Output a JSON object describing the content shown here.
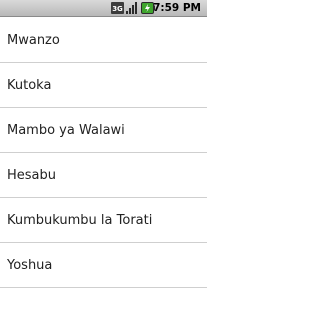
{
  "status_bar": {
    "network_label": "3G",
    "time": "7:59 PM",
    "icons": [
      "3g-icon",
      "signal-icon",
      "battery-charging-icon"
    ],
    "colors": {
      "background": "#c8c8c8",
      "battery_fill": "#3fa52e"
    }
  },
  "list": {
    "items": [
      {
        "label": "Mwanzo"
      },
      {
        "label": "Kutoka"
      },
      {
        "label": "Mambo ya Walawi"
      },
      {
        "label": "Hesabu"
      },
      {
        "label": "Kumbukumbu la Torati"
      },
      {
        "label": "Yoshua"
      },
      {
        "label": ""
      }
    ]
  }
}
